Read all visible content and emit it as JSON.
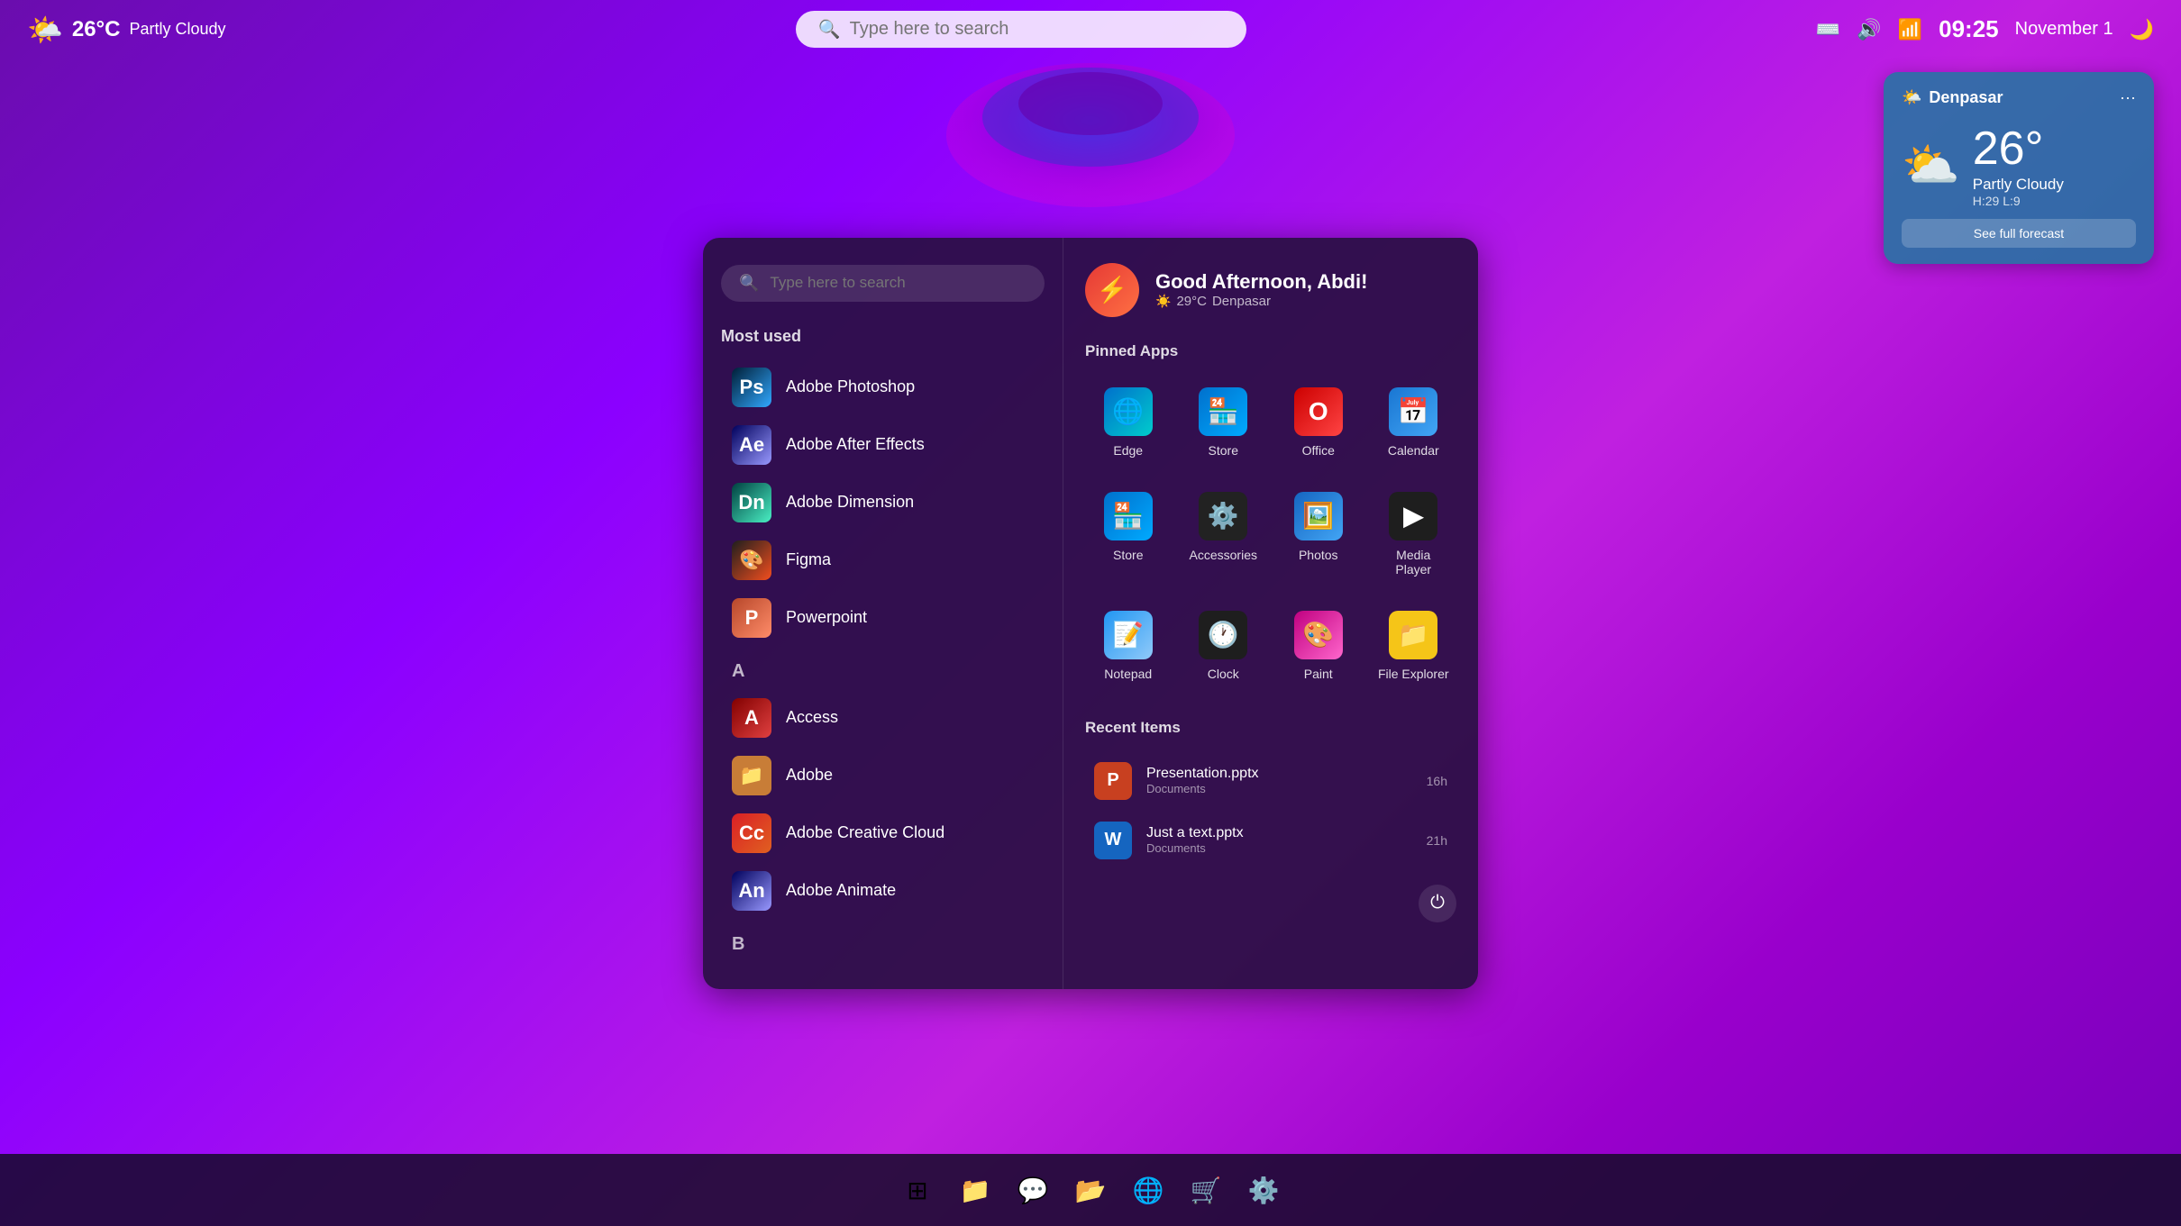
{
  "topbar": {
    "weather_icon": "🌤️",
    "temp": "26°C",
    "description": "Partly Cloudy",
    "search_placeholder": "Type here to search",
    "time": "09:25",
    "date": "November 1",
    "moon_icon": "🌙"
  },
  "weather_card": {
    "city": "Denpasar",
    "temp": "26°",
    "description": "Partly Cloudy",
    "hl": "H:29 L:9",
    "forecast_label": "See full forecast",
    "icon": "⛅"
  },
  "start_menu": {
    "search_placeholder": "Type here to search",
    "greeting": "Good Afternoon, Abdi!",
    "temp": "29°C",
    "location": "Denpasar",
    "most_used_label": "Most used",
    "alpha_a_label": "A",
    "alpha_b_label": "B",
    "most_used": [
      {
        "name": "Adobe Photoshop",
        "icon_label": "Ps",
        "icon_class": "ic-ps"
      },
      {
        "name": "Adobe After Effects",
        "icon_label": "Ae",
        "icon_class": "ic-ae"
      },
      {
        "name": "Adobe Dimension",
        "icon_label": "Dn",
        "icon_class": "ic-dn"
      },
      {
        "name": "Figma",
        "icon_label": "🎨",
        "icon_class": "ic-figma"
      },
      {
        "name": "Powerpoint",
        "icon_label": "P",
        "icon_class": "ic-ppt"
      }
    ],
    "alpha_apps": [
      {
        "name": "Access",
        "icon_label": "A",
        "icon_class": "ic-access"
      },
      {
        "name": "Adobe",
        "icon_label": "📁",
        "icon_class": "ic-adobe-folder"
      },
      {
        "name": "Adobe Creative Cloud",
        "icon_label": "Cc",
        "icon_class": "ic-cc"
      },
      {
        "name": "Adobe Animate",
        "icon_label": "An",
        "icon_class": "ic-an"
      }
    ],
    "pinned_apps_label": "Pinned Apps",
    "pinned_apps": [
      {
        "name": "Edge",
        "icon_label": "🌐",
        "icon_class": "ic-edge"
      },
      {
        "name": "Store",
        "icon_label": "🏪",
        "icon_class": "ic-store"
      },
      {
        "name": "Office",
        "icon_label": "O",
        "icon_class": "ic-office"
      },
      {
        "name": "Calendar",
        "icon_label": "📅",
        "icon_class": "ic-calendar"
      },
      {
        "name": "Store",
        "icon_label": "🏪",
        "icon_class": "ic-store"
      },
      {
        "name": "Accessories",
        "icon_label": "⚙️",
        "icon_class": "ic-accessories"
      },
      {
        "name": "Photos",
        "icon_label": "🖼️",
        "icon_class": "ic-photos"
      },
      {
        "name": "Media Player",
        "icon_label": "▶",
        "icon_class": "ic-mediaplayer"
      },
      {
        "name": "Notepad",
        "icon_label": "📝",
        "icon_class": "ic-notepad"
      },
      {
        "name": "Clock",
        "icon_label": "🕐",
        "icon_class": "ic-clock"
      },
      {
        "name": "Paint",
        "icon_label": "🎨",
        "icon_class": "ic-paint"
      },
      {
        "name": "File Explorer",
        "icon_label": "📁",
        "icon_class": "ic-fileexplorer"
      }
    ],
    "recent_label": "Recent Items",
    "recent_items": [
      {
        "name": "Presentation.pptx",
        "location": "Documents",
        "time": "16h",
        "icon": "P",
        "icon_bg": "#c84020"
      },
      {
        "name": "Just a text.pptx",
        "location": "Documents",
        "time": "21h",
        "icon": "W",
        "icon_bg": "#1565c0"
      }
    ]
  },
  "taskbar": {
    "items": [
      {
        "name": "Start",
        "icon": "⊞"
      },
      {
        "name": "File Explorer",
        "icon": "📁"
      },
      {
        "name": "Teams",
        "icon": "💬"
      },
      {
        "name": "Files",
        "icon": "📂"
      },
      {
        "name": "Edge",
        "icon": "🌐"
      },
      {
        "name": "Store",
        "icon": "🛒"
      },
      {
        "name": "Settings",
        "icon": "⚙️"
      }
    ]
  }
}
